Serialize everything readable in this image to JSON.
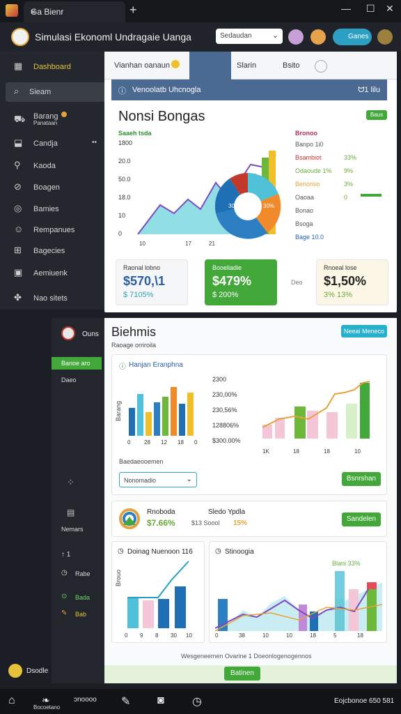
{
  "tabbar": {
    "tab_title": "Ga Bienr",
    "close": "×",
    "new_tab": "+",
    "minimize": "—",
    "maximize": "☐",
    "close_window": "✕"
  },
  "header": {
    "title": "Simulasi Ekonoml Undragaie Uanga",
    "search_placeholder": "Sedaudan",
    "pill_label": "Ganes"
  },
  "sidebar": {
    "items": [
      {
        "label": "Dashboard",
        "icon": "grid-icon"
      },
      {
        "label": "Sieam",
        "icon": "search-icon"
      },
      {
        "label": "Barang",
        "sub": "Panataan",
        "icon": "cart-icon"
      },
      {
        "label": "Candja",
        "icon": "chart-icon"
      },
      {
        "label": "Kaoda",
        "icon": "user-icon"
      },
      {
        "label": "Boagen",
        "icon": "link-icon"
      },
      {
        "label": "Bamies",
        "icon": "circle-icon"
      },
      {
        "label": "Rempanues",
        "icon": "person-icon"
      },
      {
        "label": "Bagecies",
        "icon": "table-icon"
      },
      {
        "label": "Aemiuenk",
        "icon": "folder-icon"
      },
      {
        "label": "Nao sitets",
        "icon": "puzzle-icon"
      }
    ]
  },
  "panel1": {
    "tabs": [
      "Vianhan oanaun",
      "Slarin",
      "Bsito"
    ],
    "bar_title": "Venoolatb Uhcnogla",
    "bar_right": "ᗢ1 lilu",
    "title": "Nonsi Bongas",
    "badge": "Baus",
    "chart_left_title": "Saaeh tsda",
    "y_ticks": [
      "1800",
      "20.0",
      "50.0",
      "18.0",
      "10",
      "0"
    ],
    "x_ticks": [
      "10",
      "17",
      "21"
    ],
    "pie_labels": [
      "30%",
      "30%"
    ],
    "legend_title": "Bronoo",
    "legend": [
      {
        "label": "Banpo 1i0",
        "val": "",
        "color": "#555"
      },
      {
        "label": "Bsambiot",
        "val": "33%",
        "color": "#c0392b"
      },
      {
        "label": "Odaoude 1%",
        "val": "9%",
        "color": "#6aa83a"
      },
      {
        "label": "Benonso",
        "val": "3%",
        "color": "#e6a23a"
      },
      {
        "label": "Oaoaa",
        "val": "0",
        "color": "#555"
      },
      {
        "label": "Bonao",
        "val": "",
        "color": "#555"
      },
      {
        "label": "Bsoga",
        "val": "",
        "color": "#555"
      },
      {
        "label": "Bage 10.0",
        "val": "",
        "color": "#1e62c0"
      }
    ],
    "kpis": [
      {
        "label": "Raonal lobno",
        "value": "$570,\\1",
        "sub": "$ 7105%",
        "color": "#2a5e9e"
      },
      {
        "label": "Booeliadie",
        "value": "$479%",
        "sub": "$ 200%",
        "color": "#ffffff"
      },
      {
        "label": "Rnoeal lose",
        "value": "$1,50%",
        "sub": "3% 13%",
        "color": "#222"
      }
    ],
    "kpi_mid": "Deo"
  },
  "sidebar2": {
    "title": "Ouns",
    "items": [
      "Banoe aro",
      "Daeo",
      "Nemars",
      "Rabe",
      "Bada",
      "Bab"
    ]
  },
  "panel2": {
    "title": "Biehmis",
    "subtitle": "Raoage orriroila",
    "badge": "Neeai Meneco",
    "card1_title": "Hanjan Eranphna",
    "bars_ylabel": "Barang",
    "bars_x": [
      "0",
      "28",
      "12",
      "18",
      "0"
    ],
    "pct_labels": [
      "2300",
      "230,00%",
      "230,56%",
      "128806%",
      "$300.00%"
    ],
    "line_x": [
      "1K",
      "18",
      "18",
      "10"
    ],
    "sub_label": "Baedaeooemen",
    "select_value": "Nonomadio",
    "btn1": "Bsnrshan",
    "card2_title": "Rnoboda",
    "card2_value": "$7.66%",
    "card2_sub": "Sledo Ypdla",
    "card2_detail": "$13 Soool",
    "card2_pct": "15%",
    "btn2": "Sandelen",
    "card3_title": "Doinag Nuenoon 116",
    "card3_y": "Brouo",
    "card3_x": [
      "0",
      "9",
      "8",
      "30",
      "10"
    ],
    "card4_title": "Stinoogia",
    "card4_legend": "Blani 33%",
    "card4_x": [
      "0",
      "38",
      "10",
      "10",
      "18",
      "5",
      "18"
    ],
    "footer_text": "Wesgeneemen Ovarine 1 Doeonlogenogennos",
    "footer_btn": "Batinen"
  },
  "bottombar": {
    "left": "Bocoetano",
    "right": "Eojcbonoe 650 581"
  },
  "colors": {
    "green": "#43a83a",
    "blue": "#2c7fc2",
    "teal": "#4fc1d8",
    "orange": "#f08a2a"
  }
}
